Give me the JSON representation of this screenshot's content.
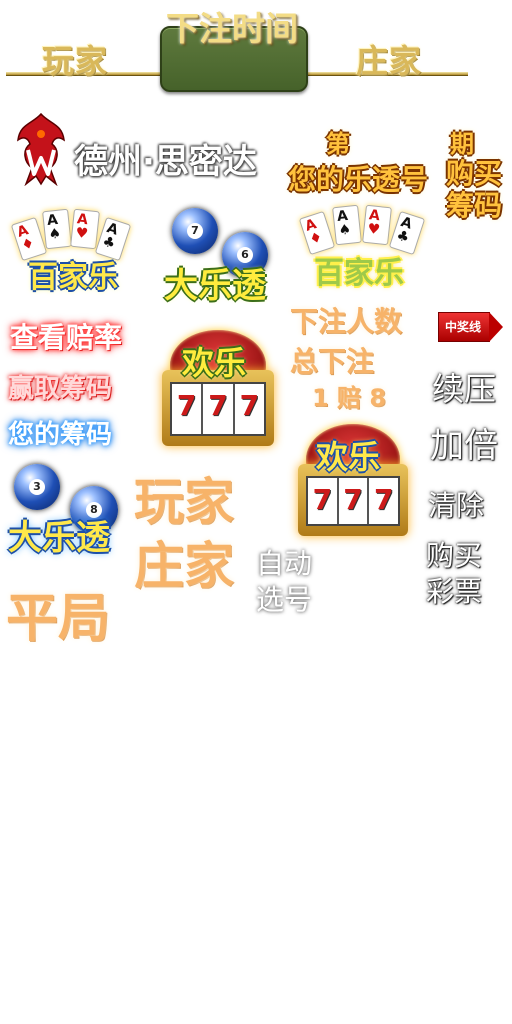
{
  "header": {
    "left_label": "玩家",
    "center_title": "下注时间",
    "right_label": "庄家"
  },
  "logo": {
    "text": "德州·思密达",
    "icon": "phoenix-logo-icon"
  },
  "period": {
    "label_left": "第",
    "label_right": "期",
    "number_label": "您的乐透号",
    "buy_line1": "购买",
    "buy_line2": "筹码"
  },
  "games": {
    "baccarat_label_1": "百家乐",
    "lotto_label_1": "大乐透",
    "baccarat_label_2": "百家乐",
    "fun_label_1": "欢乐",
    "fun_label_2": "欢乐",
    "lotto_label_2": "大乐透",
    "slot_symbol": "7"
  },
  "cards": {
    "rank": "A",
    "suits": [
      "♦",
      "♠",
      "♥",
      "♣"
    ]
  },
  "balls": {
    "numbers": [
      "7",
      "6",
      "3",
      "8"
    ]
  },
  "info": {
    "bet_count": "下注人数",
    "total_bet": "总下注",
    "odds": "1 赔 8"
  },
  "win_line": "中奖线",
  "actions": {
    "view_odds": "查看赔率",
    "win_chips": "赢取筹码",
    "your_chips": "您的筹码",
    "repeat": "续压",
    "double": "加倍",
    "clear": "清除",
    "buy_ticket_line1": "购买",
    "buy_ticket_line2": "彩票",
    "auto_pick_line1": "自动",
    "auto_pick_line2": "选号"
  },
  "bet_sides": {
    "player": "玩家",
    "banker": "庄家",
    "tie": "平局"
  }
}
